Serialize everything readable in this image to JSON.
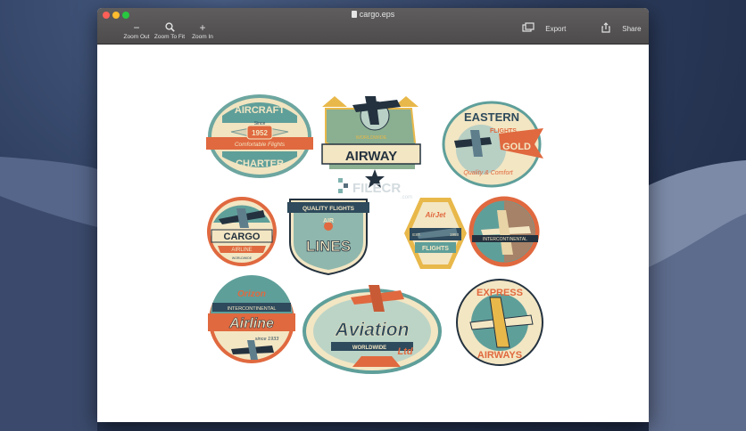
{
  "window": {
    "title": "cargo.eps",
    "toolbar": {
      "zoom_out_label": "Zoom Out",
      "zoom_fit_label": "Zoom To Fit",
      "zoom_in_label": "Zoom In",
      "export_label": "Export",
      "share_label": "Share"
    }
  },
  "icons": {
    "zoom_out": "minus-icon",
    "zoom_fit": "magnifier-icon",
    "zoom_in": "plus-icon",
    "export": "export-icon",
    "share": "share-icon"
  },
  "watermark": {
    "brand": "FILECR",
    "suffix": ".com"
  },
  "badges": {
    "aircraft": {
      "top": "AIRCRAFT",
      "since": "Since",
      "year": "1952",
      "ribbon": "Comfortable Flights",
      "bottom": "CHARTER"
    },
    "airway": {
      "small": "WORLDWIDE",
      "main": "AIRWAY"
    },
    "eastern": {
      "top": "EASTERN",
      "sub": "FLIGHTS",
      "gold": "GOLD",
      "script": "Quality & Comfort"
    },
    "cargo": {
      "main": "CARGO",
      "sub": "AIRLINE",
      "small": "WORLDWIDE"
    },
    "lines": {
      "top": "QUALITY FLIGHTS",
      "air": "AIR",
      "main": "LINES"
    },
    "airjet": {
      "script": "AirJet",
      "est": "EST.",
      "year": "1953",
      "main": "FLIGHTS"
    },
    "intercontinental": {
      "main": "INTERCONTINENTAL"
    },
    "orizon": {
      "top": "Orizon",
      "inter": "INTERCONTINENTAL",
      "main": "Airline",
      "since": "since 1933"
    },
    "aviation": {
      "main": "Aviation",
      "sub": "WORLDWIDE",
      "script": "Ltd"
    },
    "express": {
      "top": "EXPRESS",
      "bottom": "AIRWAYS"
    }
  },
  "colors": {
    "teal": "#5f9f9a",
    "orange": "#e0693f",
    "cream": "#f3e6c3",
    "navy": "#2e4a5c",
    "gold": "#e8b84a",
    "dark": "#24323f"
  }
}
